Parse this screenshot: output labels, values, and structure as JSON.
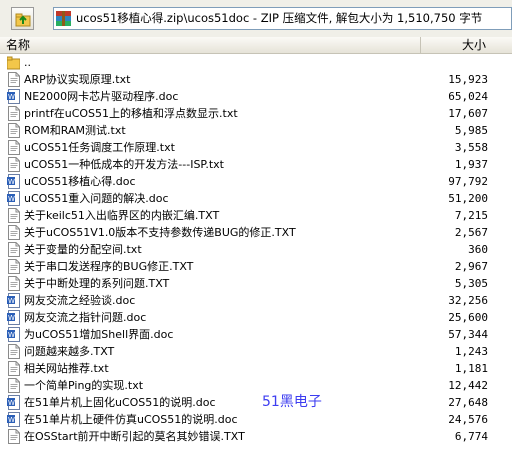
{
  "toolbar": {
    "path_text": "ucos51移植心得.zip\\ucos51doc - ZIP 压缩文件, 解包大小为 1,510,750 字节"
  },
  "columns": {
    "name": "名称",
    "size": "大小"
  },
  "parent_row": {
    "name": ".."
  },
  "files": [
    {
      "name": "ARP协议实现原理.txt",
      "size": "15,923",
      "type": "txt"
    },
    {
      "name": "NE2000网卡芯片驱动程序.doc",
      "size": "65,024",
      "type": "doc"
    },
    {
      "name": "printf在uCOS51上的移植和浮点数显示.txt",
      "size": "17,607",
      "type": "txt"
    },
    {
      "name": "ROM和RAM测试.txt",
      "size": "5,985",
      "type": "txt"
    },
    {
      "name": "uCOS51任务调度工作原理.txt",
      "size": "3,558",
      "type": "txt"
    },
    {
      "name": "uCOS51一种低成本的开发方法---ISP.txt",
      "size": "1,937",
      "type": "txt"
    },
    {
      "name": "uCOS51移植心得.doc",
      "size": "97,792",
      "type": "doc"
    },
    {
      "name": "uCOS51重入问题的解决.doc",
      "size": "51,200",
      "type": "doc"
    },
    {
      "name": "关于keilc51入出临界区的内嵌汇编.TXT",
      "size": "7,215",
      "type": "txt"
    },
    {
      "name": "关于uCOS51V1.0版本不支持参数传递BUG的修正.TXT",
      "size": "2,567",
      "type": "txt"
    },
    {
      "name": "关于变量的分配空间.txt",
      "size": "360",
      "type": "txt"
    },
    {
      "name": "关于串口发送程序的BUG修正.TXT",
      "size": "2,967",
      "type": "txt"
    },
    {
      "name": "关于中断处理的系列问题.TXT",
      "size": "5,305",
      "type": "txt"
    },
    {
      "name": "网友交流之经验谈.doc",
      "size": "32,256",
      "type": "doc"
    },
    {
      "name": "网友交流之指针问题.doc",
      "size": "25,600",
      "type": "doc"
    },
    {
      "name": "为uCOS51增加Shell界面.doc",
      "size": "57,344",
      "type": "doc"
    },
    {
      "name": "问题越来越多.TXT",
      "size": "1,243",
      "type": "txt"
    },
    {
      "name": "相关网站推荐.txt",
      "size": "1,181",
      "type": "txt"
    },
    {
      "name": "一个简单Ping的实现.txt",
      "size": "12,442",
      "type": "txt"
    },
    {
      "name": "在51单片机上固化uCOS51的说明.doc",
      "size": "27,648",
      "type": "doc"
    },
    {
      "name": "在51单片机上硬件仿真uCOS51的说明.doc",
      "size": "24,576",
      "type": "doc"
    },
    {
      "name": "在OSStart前开中断引起的莫名其妙错误.TXT",
      "size": "6,774",
      "type": "txt"
    }
  ],
  "watermark": "51黑电子",
  "colors": {
    "folder": "#f3c74a",
    "doc_blue": "#2b5fb8",
    "watermark": "#3d3df0"
  }
}
